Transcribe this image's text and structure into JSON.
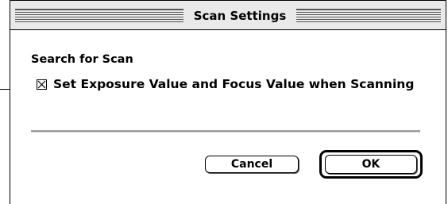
{
  "window": {
    "title": "Scan Settings"
  },
  "section": {
    "label": "Search for Scan"
  },
  "checkbox": {
    "label": "Set Exposure Value and Focus Value when Scanning",
    "checked": true
  },
  "buttons": {
    "cancel_label": "Cancel",
    "ok_label": "OK"
  }
}
